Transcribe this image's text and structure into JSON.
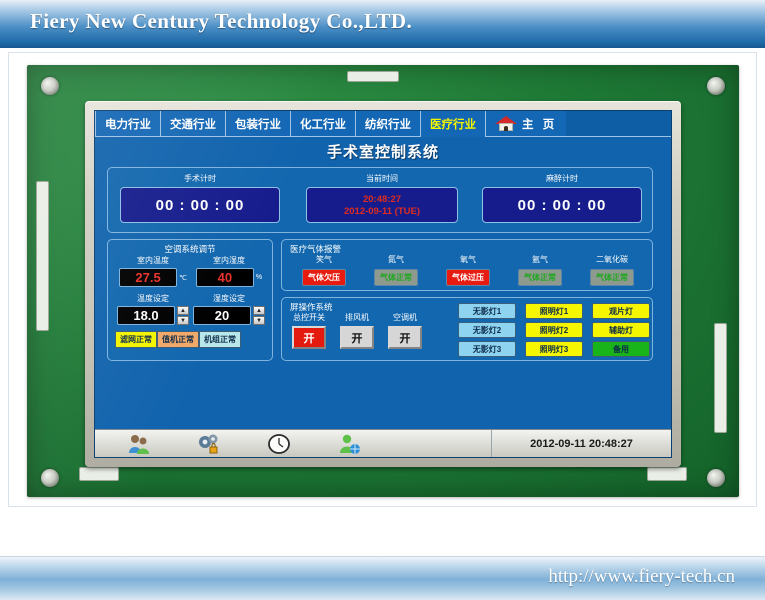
{
  "header": {
    "company": "Fiery New Century Technology Co.,LTD."
  },
  "footer": {
    "url": "http://www.fiery-tech.cn"
  },
  "tabs": [
    {
      "label": "电力行业",
      "active": false
    },
    {
      "label": "交通行业",
      "active": false
    },
    {
      "label": "包装行业",
      "active": false
    },
    {
      "label": "化工行业",
      "active": false
    },
    {
      "label": "纺织行业",
      "active": false
    },
    {
      "label": "医疗行业",
      "active": true
    }
  ],
  "home_tab": {
    "label": "主 页",
    "icon": "house-icon"
  },
  "screen": {
    "title": "手术室控制系统",
    "timers": [
      {
        "caption": "手术计时",
        "value": "00 : 00 : 00"
      },
      {
        "caption": "当前时间",
        "time": "20:48:27",
        "date": "2012-09-11 (TUE)"
      },
      {
        "caption": "麻醉计时",
        "value": "00 : 00 : 00"
      }
    ],
    "ac_panel": {
      "title": "空调系统调节",
      "fields": [
        {
          "caption": "室内温度",
          "value": "27.5",
          "unit": "℃",
          "style": "red",
          "spinner": false
        },
        {
          "caption": "室内湿度",
          "value": "40",
          "unit": "%",
          "style": "red",
          "spinner": false
        },
        {
          "caption": "温度设定",
          "value": "18.0",
          "unit": "",
          "style": "white",
          "spinner": true
        },
        {
          "caption": "湿度设定",
          "value": "20",
          "unit": "",
          "style": "white",
          "spinner": true
        }
      ],
      "badges": [
        {
          "label": "滤网正常",
          "color": "yellow"
        },
        {
          "label": "值机正常",
          "color": "orange"
        },
        {
          "label": "机组正常",
          "color": "cyan"
        }
      ]
    },
    "gas_panel": {
      "title": "医疗气体报警",
      "gases": [
        {
          "name": "笑气",
          "status": "气体欠压",
          "state": "alarm"
        },
        {
          "name": "氮气",
          "status": "气体正常",
          "state": "ok"
        },
        {
          "name": "氧气",
          "status": "气体过压",
          "state": "alarm"
        },
        {
          "name": "氩气",
          "status": "气体正常",
          "state": "ok"
        },
        {
          "name": "二氧化碳",
          "status": "气体正常",
          "state": "ok"
        }
      ]
    },
    "op_panel": {
      "title": "屏操作系统",
      "switches": [
        {
          "caption": "总控开关",
          "label": "开",
          "state": "red"
        },
        {
          "caption": "排风机",
          "label": "开",
          "state": "gray"
        },
        {
          "caption": "空调机",
          "label": "开",
          "state": "gray"
        }
      ],
      "lamps": [
        {
          "label": "无影灯1",
          "color": "cyan"
        },
        {
          "label": "照明灯1",
          "color": "yellow"
        },
        {
          "label": "观片灯",
          "color": "yellow"
        },
        {
          "label": "无影灯2",
          "color": "cyan"
        },
        {
          "label": "照明灯2",
          "color": "yellow"
        },
        {
          "label": "辅助灯",
          "color": "yellow"
        },
        {
          "label": "无影灯3",
          "color": "cyan"
        },
        {
          "label": "照明灯3",
          "color": "yellow"
        },
        {
          "label": "备用",
          "color": "green"
        }
      ]
    },
    "statusbar": {
      "icons": [
        "users-icon",
        "gears-lock-icon",
        "clock-icon",
        "user-network-icon"
      ],
      "timestamp": "2012-09-11 20:48:27"
    }
  },
  "colors": {
    "lcd_blue": "#1163ad",
    "accent_yellow": "#f5f500",
    "alarm_red": "#e81b10",
    "ok_green": "#19b419",
    "pcb_green": "#1f7a36"
  }
}
